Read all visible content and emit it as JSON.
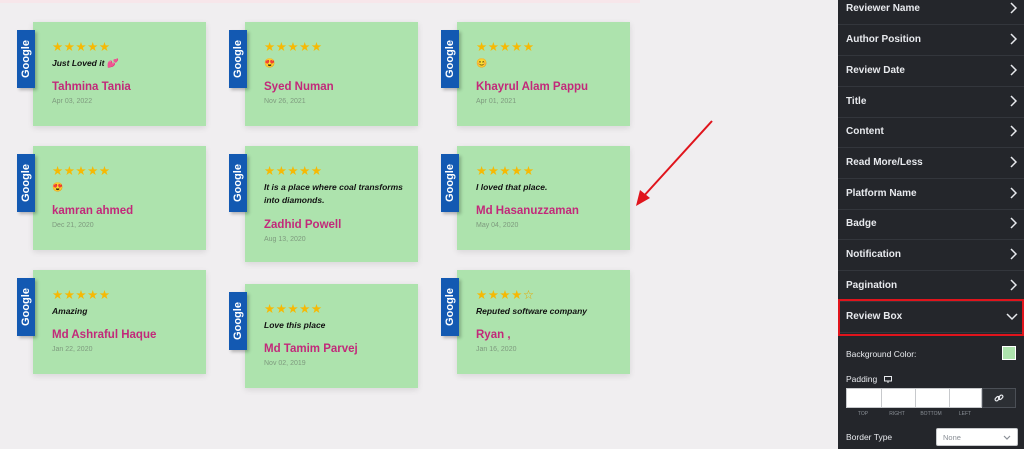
{
  "reviews": [
    {
      "platform": "Google",
      "stars": 5,
      "text": "Just Loved it 💕",
      "name": "Tahmina Tania",
      "date": "Apr 03, 2022"
    },
    {
      "platform": "Google",
      "stars": 5,
      "text": "😍",
      "name": "Syed Numan",
      "date": "Nov 26, 2021"
    },
    {
      "platform": "Google",
      "stars": 5,
      "text": "😊",
      "name": "Khayrul Alam Pappu",
      "date": "Apr 01, 2021"
    },
    {
      "platform": "Google",
      "stars": 5,
      "text": "😍",
      "name": "kamran ahmed",
      "date": "Dec 21, 2020"
    },
    {
      "platform": "Google",
      "stars": 5,
      "text": "It is a place where coal transforms into diamonds.",
      "name": "Zadhid Powell",
      "date": "Aug 13, 2020"
    },
    {
      "platform": "Google",
      "stars": 5,
      "text": "I loved that place.",
      "name": "Md Hasanuzzaman",
      "date": "May 04, 2020"
    },
    {
      "platform": "Google",
      "stars": 5,
      "text": "Amazing",
      "name": "Md Ashraful Haque",
      "date": "Jan 22, 2020"
    },
    {
      "platform": "Google",
      "stars": 5,
      "text": "Love this place",
      "name": "Md Tamim Parvej",
      "date": "Nov 02, 2019"
    },
    {
      "platform": "Google",
      "stars": 4,
      "text": "Reputed software company",
      "name": "Ryan ,",
      "date": "Jan 16, 2020"
    }
  ],
  "stars_full": "★★★★★",
  "stars_four": "★★★★",
  "star_empty": "☆",
  "panel": {
    "sections": [
      "Reviewer Name",
      "Author Position",
      "Review Date",
      "Title",
      "Content",
      "Read More/Less",
      "Platform Name",
      "Badge",
      "Notification",
      "Pagination"
    ],
    "active_section": "Review Box",
    "background_color_label": "Background Color:",
    "background_color_value": "#ade3ad",
    "padding_label": "Padding",
    "padding_sides": [
      "TOP",
      "RIGHT",
      "BOTTOM",
      "LEFT"
    ],
    "border_type_label": "Border Type",
    "border_type_value": "None"
  },
  "colors": {
    "accent": "#c2297a",
    "highlight": "#e0141c",
    "google_tab": "#1359b2",
    "card_bg": "#ade3ad"
  }
}
